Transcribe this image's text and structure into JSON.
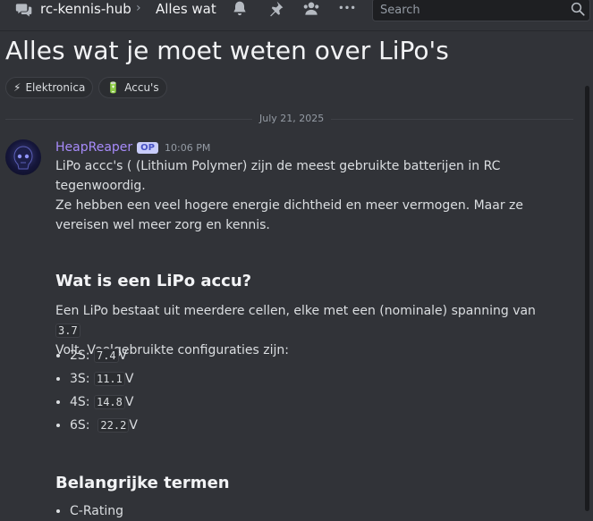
{
  "topbar": {
    "server_name": "rc-kennis-hub",
    "separator": "›",
    "thread_name": "Alles wat je",
    "icons": [
      "forum-icon",
      "bell-icon",
      "pin-icon",
      "members-icon",
      "more-icon",
      "search-icon"
    ],
    "search_placeholder": "Search"
  },
  "thread": {
    "title": "Alles wat je moet weten over LiPo's",
    "tags": [
      {
        "emoji": "⚡",
        "label": "Elektronica"
      },
      {
        "emoji": "🔋",
        "label": "Accu's"
      }
    ]
  },
  "date_divider": "July 21, 2025",
  "message": {
    "author": "HeapReaper",
    "badge": "OP",
    "timestamp": "10:06 PM",
    "intro_line1": "LiPo accc's ( (Lithium Polymer) zijn de meest gebruikte batterijen in RC tegenwoordig.",
    "intro_line2": "Ze hebben een veel hogere energie dichtheid en meer vermogen. Maar ze vereisen wel meer zorg en kennis.",
    "heading1": "Wat is een LiPo accu?",
    "para1_before": "Een LiPo bestaat uit meerdere cellen, elke met een (nominale) spanning van ",
    "para1_code": "3.7",
    "para1_after": "Volt. Veelgebruikte configuraties zijn:",
    "configs": [
      {
        "label": "2S: ",
        "value": "7.4",
        "unit": "V"
      },
      {
        "label": "3S: ",
        "value": "11.1",
        "unit": "V"
      },
      {
        "label": "4S: ",
        "value": "14.8",
        "unit": "V"
      },
      {
        "label": "6S:  ",
        "value": "22.2",
        "unit": "V"
      }
    ],
    "heading2": "Belangrijke termen",
    "terms": [
      "C-Rating"
    ]
  },
  "colors": {
    "background": "#313338",
    "author": "#a78bfa",
    "text": "#dbdee1"
  }
}
